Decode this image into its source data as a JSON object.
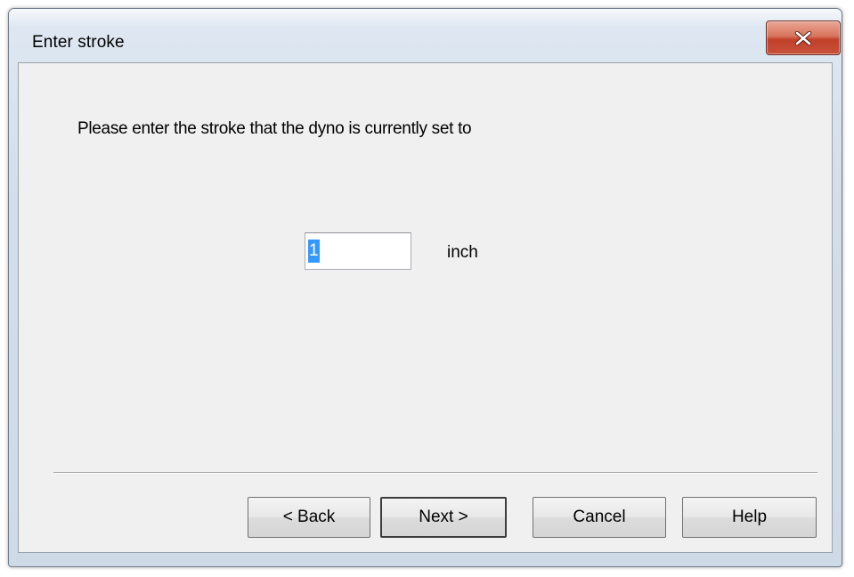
{
  "dialog": {
    "title": "Enter stroke",
    "close_icon": "close-icon"
  },
  "content": {
    "prompt": "Please enter the stroke that the dyno is currently set to",
    "stroke_value": "1",
    "stroke_unit": "inch"
  },
  "buttons": {
    "back": "< Back",
    "next": "Next >",
    "cancel": "Cancel",
    "help": "Help"
  },
  "colors": {
    "close_button": "#c8513a",
    "selection": "#3399ff",
    "client_background": "#f0f0f0"
  }
}
